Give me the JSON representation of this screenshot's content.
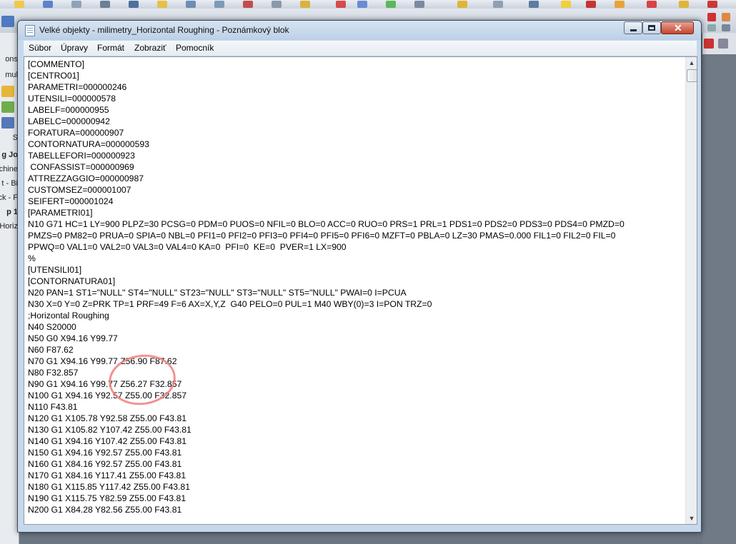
{
  "window": {
    "title": "Velké objekty - milimetry_Horizontal Roughing - Poznámkový blok",
    "minimize_glyph": "",
    "close_glyph": "✕"
  },
  "menu": {
    "items": [
      "Súbor",
      "Úpravy",
      "Formát",
      "Zobraziť",
      "Pomocník"
    ]
  },
  "background_app": {
    "left_panel_labels": [
      "ons",
      "mul",
      "S",
      "g Jo",
      "chine",
      "t - Bi",
      "ck - F",
      "p 1",
      "Horiz"
    ]
  },
  "editor": {
    "lines": [
      "[COMMENTO]",
      "[CENTRO01]",
      "PARAMETRI=000000246",
      "UTENSILI=000000578",
      "LABELF=000000955",
      "LABELC=000000942",
      "FORATURA=000000907",
      "CONTORNATURA=000000593",
      "TABELLEFORI=000000923",
      " CONFASSIST=000000969",
      "ATTREZZAGGIO=000000987",
      "CUSTOMSEZ=000001007",
      "SEIFERT=000001024",
      "[PARAMETRI01]",
      "N10 G71 HC=1 LY=900 PLPZ=30 PCSG=0 PDM=0 PUOS=0 NFIL=0 BLO=0 ACC=0 RUO=0 PRS=1 PRL=1 PDS1=0 PDS2=0 PDS3=0 PDS4=0 PMZD=0",
      "PMZS=0 PM82=0 PRUA=0 SPIA=0 NBL=0 PFI1=0 PFI2=0 PFI3=0 PFI4=0 PFI5=0 PFI6=0 MZFT=0 PBLA=0 LZ=30 PMAS=0.000 FIL1=0 FIL2=0 FIL=0",
      "PPWQ=0 VAL1=0 VAL2=0 VAL3=0 VAL4=0 KA=0  PFI=0  KE=0  PVER=1 LX=900",
      "%",
      "[UTENSILI01]",
      "[CONTORNATURA01]",
      "N20 PAN=1 ST1=\"NULL\" ST4=\"NULL\" ST23=\"NULL\" ST3=\"NULL\" ST5=\"NULL\" PWAI=0 I=PCUA",
      "N30 X=0 Y=0 Z=PRK TP=1 PRF=49 F=6 AX=X,Y,Z  G40 PELO=0 PUL=1 M40 WBY(0)=3 I=PON TRZ=0",
      ";Horizontal Roughing",
      "N40 S20000",
      "N50 G0 X94.16 Y99.77",
      "N60 F87.62",
      "N70 G1 X94.16 Y99.77 Z56.90 F87.62",
      "N80 F32.857",
      "N90 G1 X94.16 Y99.77 Z56.27 F32.857",
      "N100 G1 X94.16 Y92.57 Z55.00 F32.857",
      "N110 F43.81",
      "N120 G1 X105.78 Y92.58 Z55.00 F43.81",
      "N130 G1 X105.82 Y107.42 Z55.00 F43.81",
      "N140 G1 X94.16 Y107.42 Z55.00 F43.81",
      "N150 G1 X94.16 Y92.57 Z55.00 F43.81",
      "N160 G1 X84.16 Y92.57 Z55.00 F43.81",
      "N170 G1 X84.16 Y117.41 Z55.00 F43.81",
      "N180 G1 X115.85 Y117.42 Z55.00 F43.81",
      "N190 G1 X115.75 Y82.59 Z55.00 F43.81",
      "N200 G1 X84.28 Y82.56 Z55.00 F43.81"
    ]
  },
  "scrollbar": {
    "up_glyph": "▲",
    "down_glyph": "▼"
  },
  "colors": {
    "annotation": "#f07f7f",
    "title_bar": "#c7d8ea",
    "close_button": "#c4452f"
  }
}
